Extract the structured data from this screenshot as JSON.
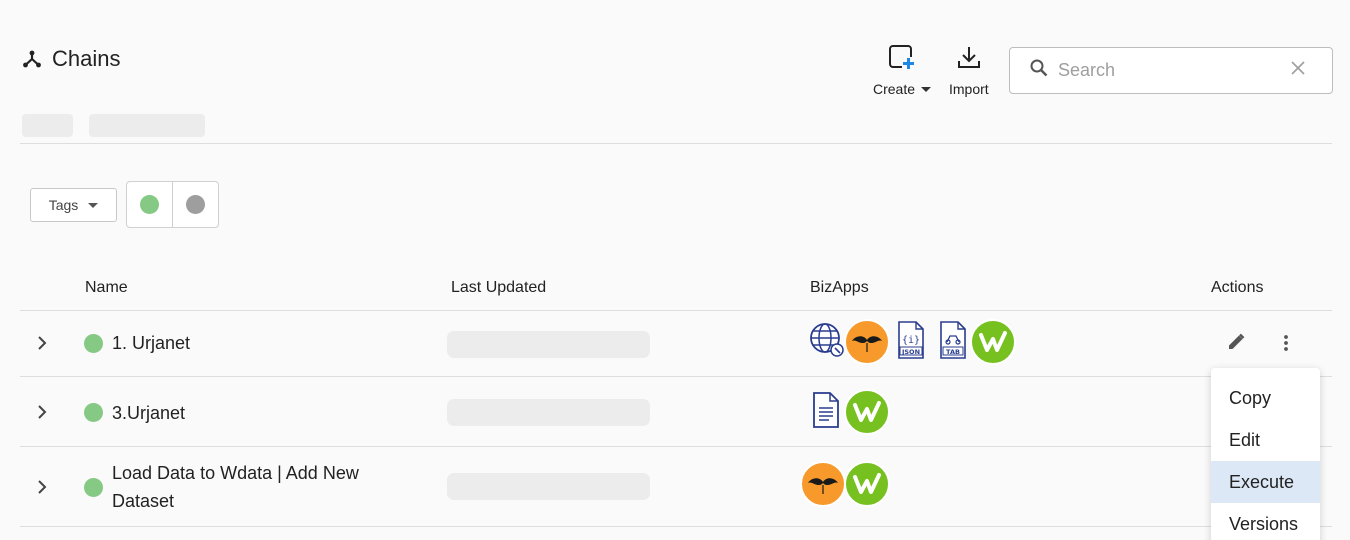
{
  "header": {
    "title": "Chains",
    "title_icon": "chain-fork-icon",
    "create_label": "Create",
    "import_label": "Import",
    "search_placeholder": "Search"
  },
  "filters": {
    "tags_label": "Tags",
    "status_colors": {
      "active": "#85c985",
      "inactive": "#9e9e9e"
    }
  },
  "table": {
    "columns": {
      "name": "Name",
      "last_updated": "Last Updated",
      "bizapps": "BizApps",
      "actions": "Actions"
    },
    "rows": [
      {
        "name": "1. Urjanet",
        "bizapps": [
          "globe-api-icon",
          "mustache-icon",
          "json-file-icon",
          "tab-file-icon",
          "wdata-icon"
        ]
      },
      {
        "name": "3.Urjanet",
        "bizapps": [
          "text-document-icon",
          "wdata-icon"
        ]
      },
      {
        "name_line1": "Load Data to Wdata | Add New",
        "name_line2": "Dataset",
        "bizapps": [
          "mustache-icon",
          "wdata-icon"
        ]
      }
    ]
  },
  "context_menu": {
    "items": [
      "Copy",
      "Edit",
      "Execute",
      "Versions"
    ],
    "highlighted": "Execute"
  },
  "colors": {
    "wdata_green": "#76c11f",
    "mustache_orange": "#f79a2b",
    "doc_blue": "#2a3d8f",
    "highlight": "#dde8f7"
  }
}
